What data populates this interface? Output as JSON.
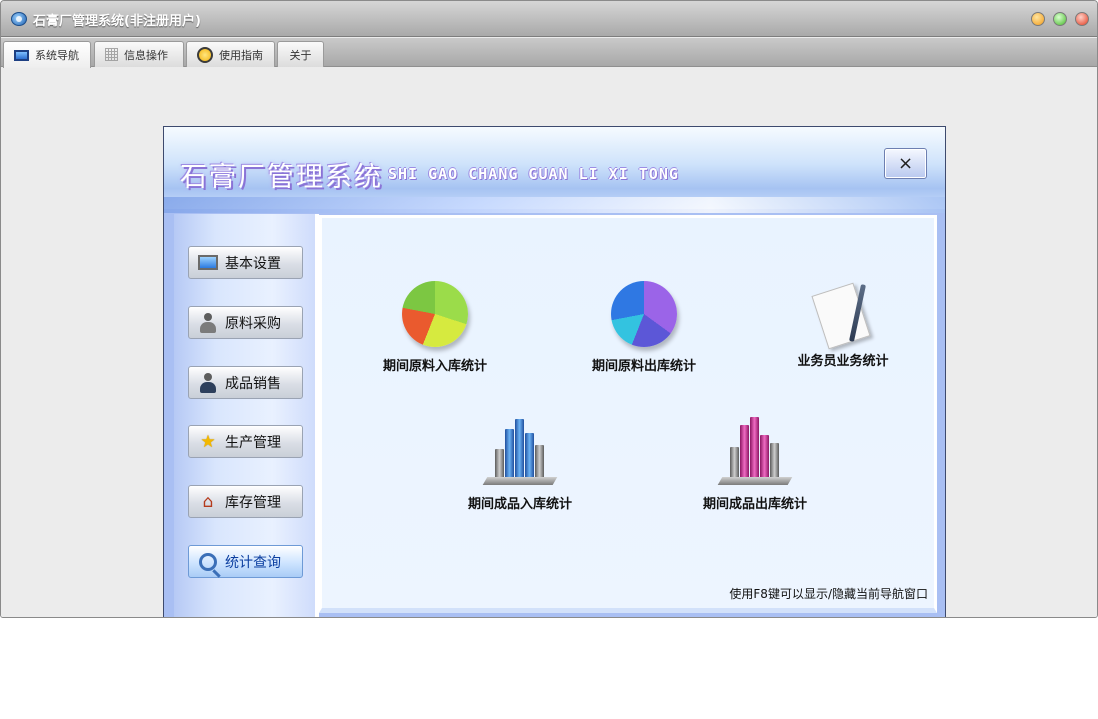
{
  "window": {
    "title": "石膏厂管理系统(非注册用户)"
  },
  "tabs": [
    {
      "label": "系统导航",
      "icon": "monitor-icon",
      "active": true
    },
    {
      "label": "信息操作",
      "icon": "grid-icon",
      "active": false
    },
    {
      "label": "使用指南",
      "icon": "guide-icon",
      "active": false
    },
    {
      "label": "关于",
      "icon": "",
      "active": false
    }
  ],
  "panel": {
    "title": "石膏厂管理系统",
    "subtitle": "SHI GAO CHANG GUAN LI XI TONG",
    "close_label": "×"
  },
  "sidebar": {
    "items": [
      {
        "label": "基本设置",
        "icon": "monitor-icon"
      },
      {
        "label": "原料采购",
        "icon": "person-icon"
      },
      {
        "label": "成品销售",
        "icon": "salesman-icon"
      },
      {
        "label": "生产管理",
        "icon": "star-icon"
      },
      {
        "label": "库存管理",
        "icon": "house-icon"
      },
      {
        "label": "统计查询",
        "icon": "search-icon",
        "active": true
      }
    ]
  },
  "main": {
    "items": [
      {
        "label": "期间原料入库统计",
        "icon": "pie-chart-icon"
      },
      {
        "label": "期间原料出库统计",
        "icon": "pie-chart-icon"
      },
      {
        "label": "业务员业务统计",
        "icon": "notepad-icon"
      },
      {
        "label": "期间成品入库统计",
        "icon": "bar-chart-icon"
      },
      {
        "label": "期间成品出库统计",
        "icon": "bar-chart-icon"
      }
    ],
    "hint": "使用F8键可以显示/隐藏当前导航窗口"
  },
  "colors": {
    "accent": "#3a6fb8",
    "banner_text_shadow": "#8a73d6",
    "window_close": "#e23a1e",
    "window_min": "#f29b1a",
    "window_max": "#46b82a"
  }
}
